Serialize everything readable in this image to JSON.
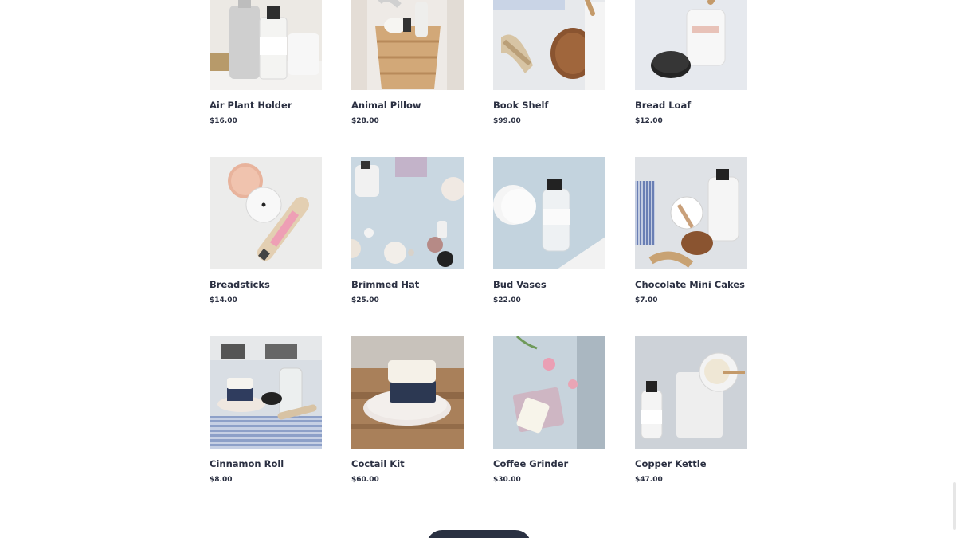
{
  "products": [
    {
      "name": "Air Plant Holder",
      "price": "$16.00",
      "bg": "#ece9e4",
      "icon": "product-photo-bottles-icon"
    },
    {
      "name": "Animal Pillow",
      "price": "$28.00",
      "bg": "#eeeae6",
      "icon": "product-photo-basket-icon"
    },
    {
      "name": "Book Shelf",
      "price": "$99.00",
      "bg": "#e7e9ec",
      "icon": "product-photo-brush-icon"
    },
    {
      "name": "Bread Loaf",
      "price": "$12.00",
      "bg": "#e6e9ee",
      "icon": "product-photo-jar-icon"
    },
    {
      "name": "Breadsticks",
      "price": "$14.00",
      "bg": "#ececeb",
      "icon": "product-photo-compact-icon"
    },
    {
      "name": "Brimmed Hat",
      "price": "$25.00",
      "bg": "#c9d7e1",
      "icon": "product-photo-flatlay-icon"
    },
    {
      "name": "Bud Vases",
      "price": "$22.00",
      "bg": "#c3d3de",
      "icon": "product-photo-bottle-icon"
    },
    {
      "name": "Chocolate Mini Cakes",
      "price": "$7.00",
      "bg": "#dfe2e6",
      "icon": "product-photo-spoon-icon"
    },
    {
      "name": "Cinnamon Roll",
      "price": "$8.00",
      "bg": "#d9dee4",
      "icon": "product-photo-soap-set-icon"
    },
    {
      "name": "Coctail Kit",
      "price": "$60.00",
      "bg": "#a9805a",
      "icon": "product-photo-soap-wood-icon"
    },
    {
      "name": "Coffee Grinder",
      "price": "$30.00",
      "bg": "#c7d3dc",
      "icon": "product-photo-soap-tray-icon"
    },
    {
      "name": "Copper Kettle",
      "price": "$47.00",
      "bg": "#cdd2d8",
      "icon": "product-photo-bottle-bowl-icon"
    }
  ],
  "load_more_color": "#2a3142"
}
